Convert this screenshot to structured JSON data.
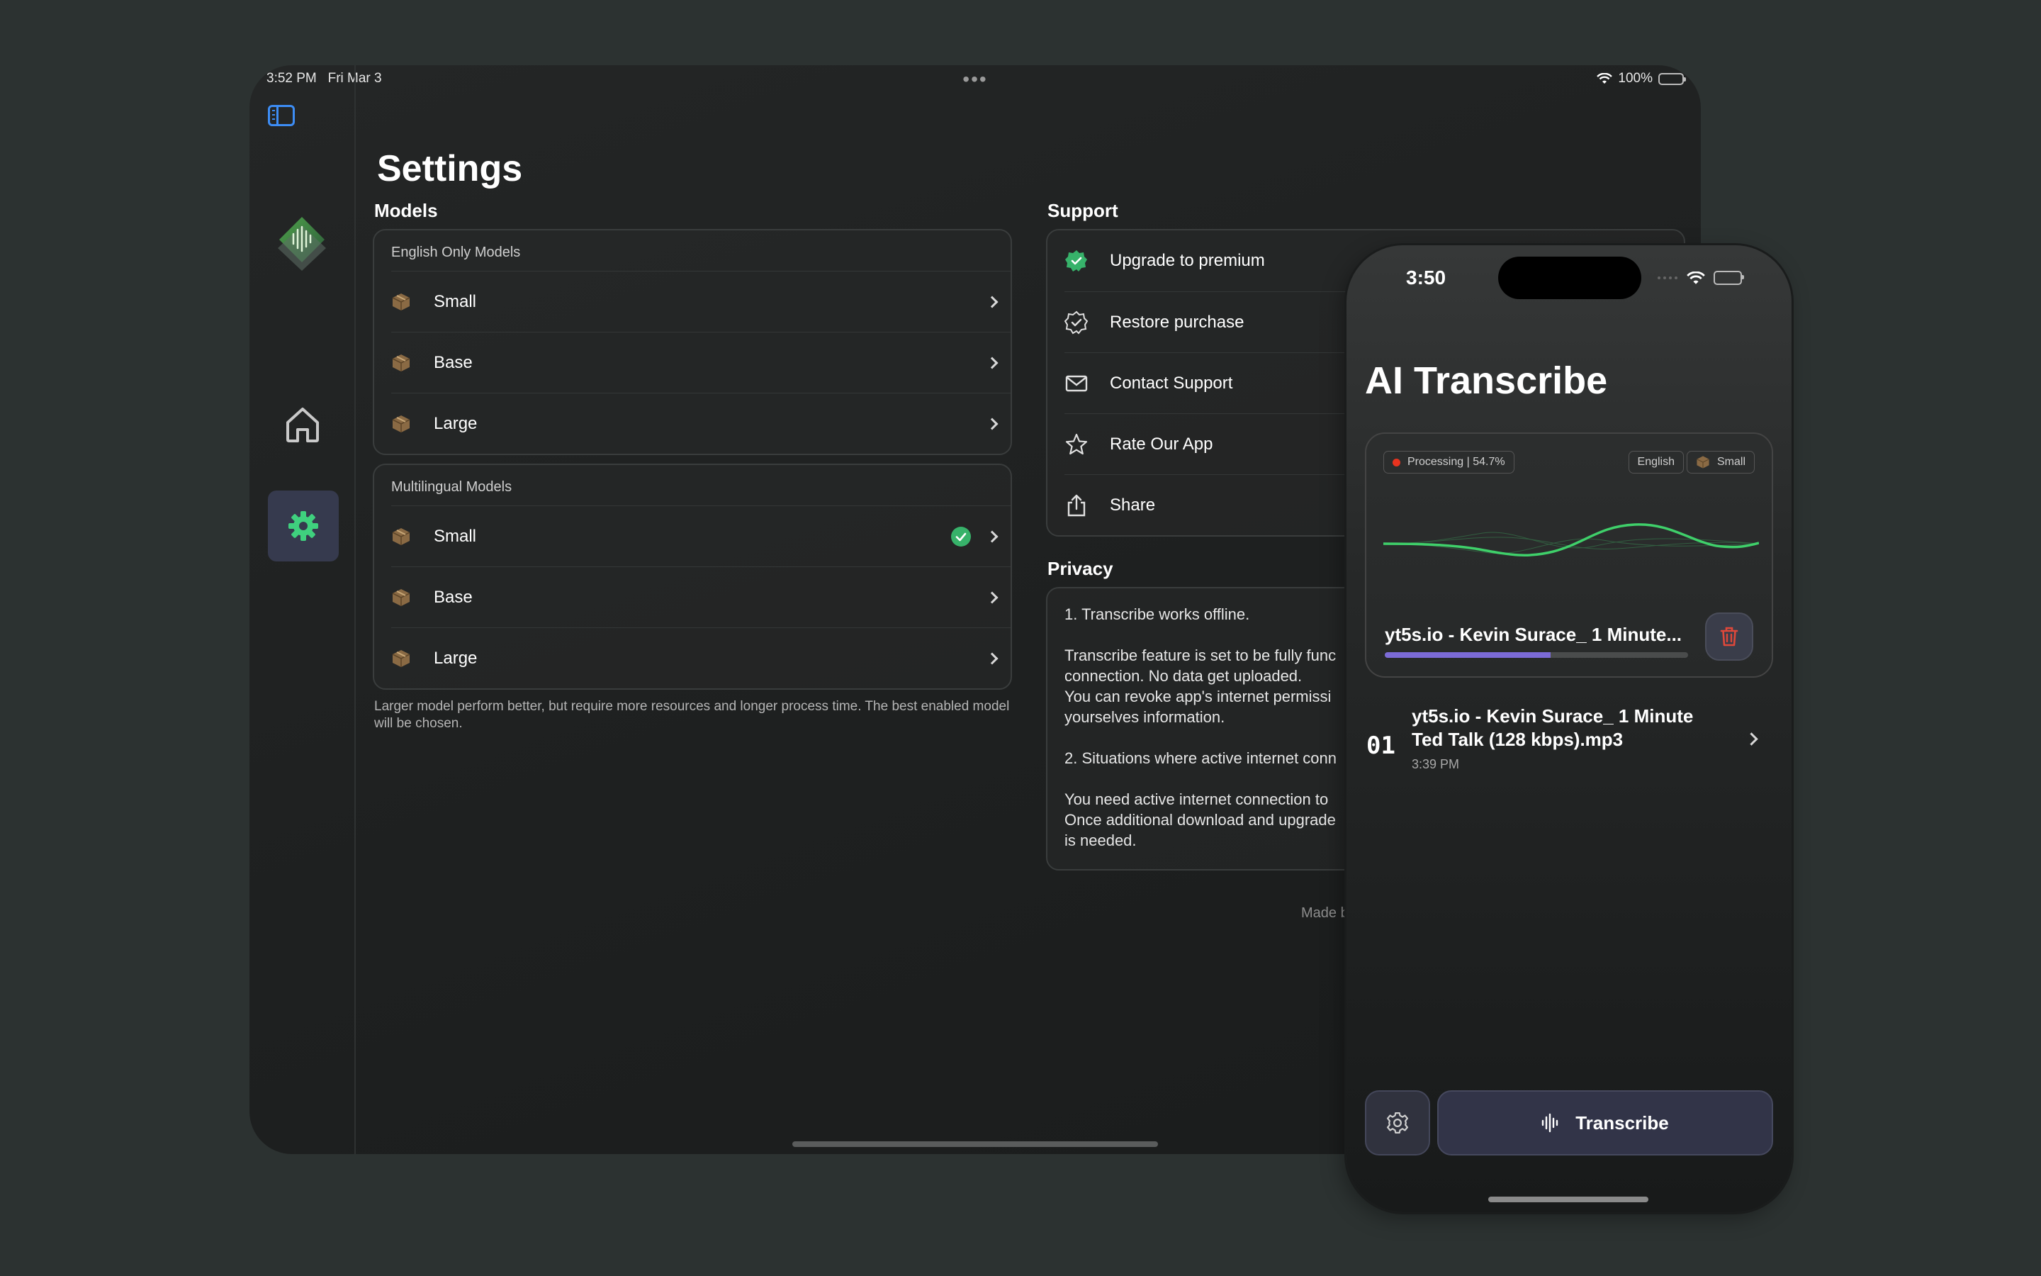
{
  "ipad": {
    "status": {
      "time": "3:52 PM",
      "date": "Fri Mar 3",
      "battery": "100%"
    },
    "title": "Settings",
    "models": {
      "heading": "Models",
      "english_group": {
        "title": "English Only Models",
        "items": [
          {
            "label": "Small",
            "selected": false
          },
          {
            "label": "Base",
            "selected": false
          },
          {
            "label": "Large",
            "selected": false
          }
        ]
      },
      "multilingual_group": {
        "title": "Multilingual Models",
        "items": [
          {
            "label": "Small",
            "selected": true
          },
          {
            "label": "Base",
            "selected": false
          },
          {
            "label": "Large",
            "selected": false
          }
        ]
      },
      "footnote": "Larger model perform better, but require more resources and longer process time. The best enabled model will be chosen."
    },
    "support": {
      "heading": "Support",
      "items": [
        {
          "label": "Upgrade to premium",
          "icon": "premium-badge-icon"
        },
        {
          "label": "Restore purchase",
          "icon": "restore-badge-icon"
        },
        {
          "label": "Contact Support",
          "icon": "mail-icon"
        },
        {
          "label": "Rate Our App",
          "icon": "star-icon"
        },
        {
          "label": "Share",
          "icon": "share-icon"
        }
      ]
    },
    "privacy": {
      "heading": "Privacy",
      "body": "1. Transcribe works offline.\n\nTranscribe feature is set to be fully func\nconnection. No data get uploaded.\nYou can revoke app's internet permissi\nyourselves information.\n\n2. Situations where active internet conn\n\nYou need active internet connection to\nOnce additional download and upgrade\nis needed."
    },
    "made_by": "Made b"
  },
  "iphone": {
    "status": {
      "time": "3:50"
    },
    "title": "AI Transcribe",
    "current": {
      "status_label": "Processing | 54.7%",
      "progress": 0.547,
      "language": "English",
      "model": "Small",
      "file_name": "yt5s.io - Kevin Surace_ 1 Minute..."
    },
    "list": [
      {
        "index": "01",
        "title": "yt5s.io - Kevin Surace_ 1 Minute Ted Talk (128 kbps).mp3",
        "time": "3:39 PM"
      }
    ],
    "transcribe_label": "Transcribe"
  },
  "colors": {
    "accent_green": "#37b26a",
    "link_blue": "#3d8df5",
    "progress_purple": "#7c6bd6",
    "recording_red": "#e8331f",
    "delete_red": "#e0483a"
  }
}
